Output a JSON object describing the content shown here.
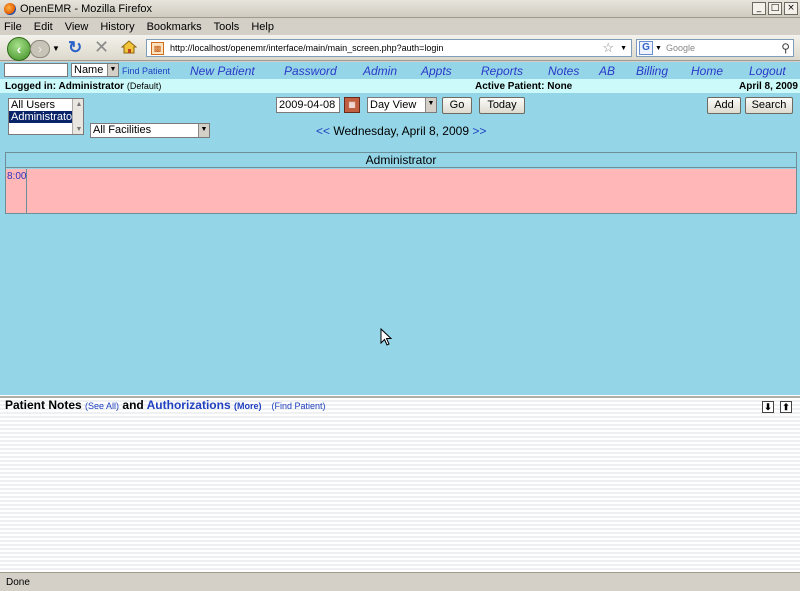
{
  "window": {
    "title": "OpenEMR - Mozilla Firefox",
    "controls": [
      "_",
      "□",
      "×"
    ]
  },
  "menubar": [
    "File",
    "Edit",
    "View",
    "History",
    "Bookmarks",
    "Tools",
    "Help"
  ],
  "navbar": {
    "url": "http://localhost/openemr/interface/main/main_screen.php?auth=login",
    "search_placeholder": "Google"
  },
  "topnav": {
    "find_select": "Name",
    "find_link": "Find Patient",
    "links": [
      "New Patient",
      "Password",
      "Admin",
      "Appts",
      "Reports",
      "Notes",
      "AB",
      "Billing",
      "Home",
      "Logout"
    ]
  },
  "status": {
    "logged_in_label": "Logged in: Administrator",
    "logged_in_default": "(Default)",
    "active_patient": "Active Patient: None",
    "date": "April 8, 2009"
  },
  "calendar": {
    "users": [
      "All Users",
      "Administrator"
    ],
    "facility": "All Facilities",
    "date_input": "2009-04-08",
    "view": "Day View",
    "go_label": "Go",
    "today_label": "Today",
    "add_label": "Add",
    "search_label": "Search",
    "prev": "<<",
    "next": ">>",
    "current_date": "Wednesday, April 8, 2009",
    "provider": "Administrator",
    "time_slot": "8:00"
  },
  "notes": {
    "title": "Patient Notes",
    "see_all": "(See All)",
    "and": "and",
    "authorizations": "Authorizations",
    "more": "(More)",
    "find_patient": "(Find Patient)"
  },
  "statusbar": {
    "text": "Done"
  }
}
